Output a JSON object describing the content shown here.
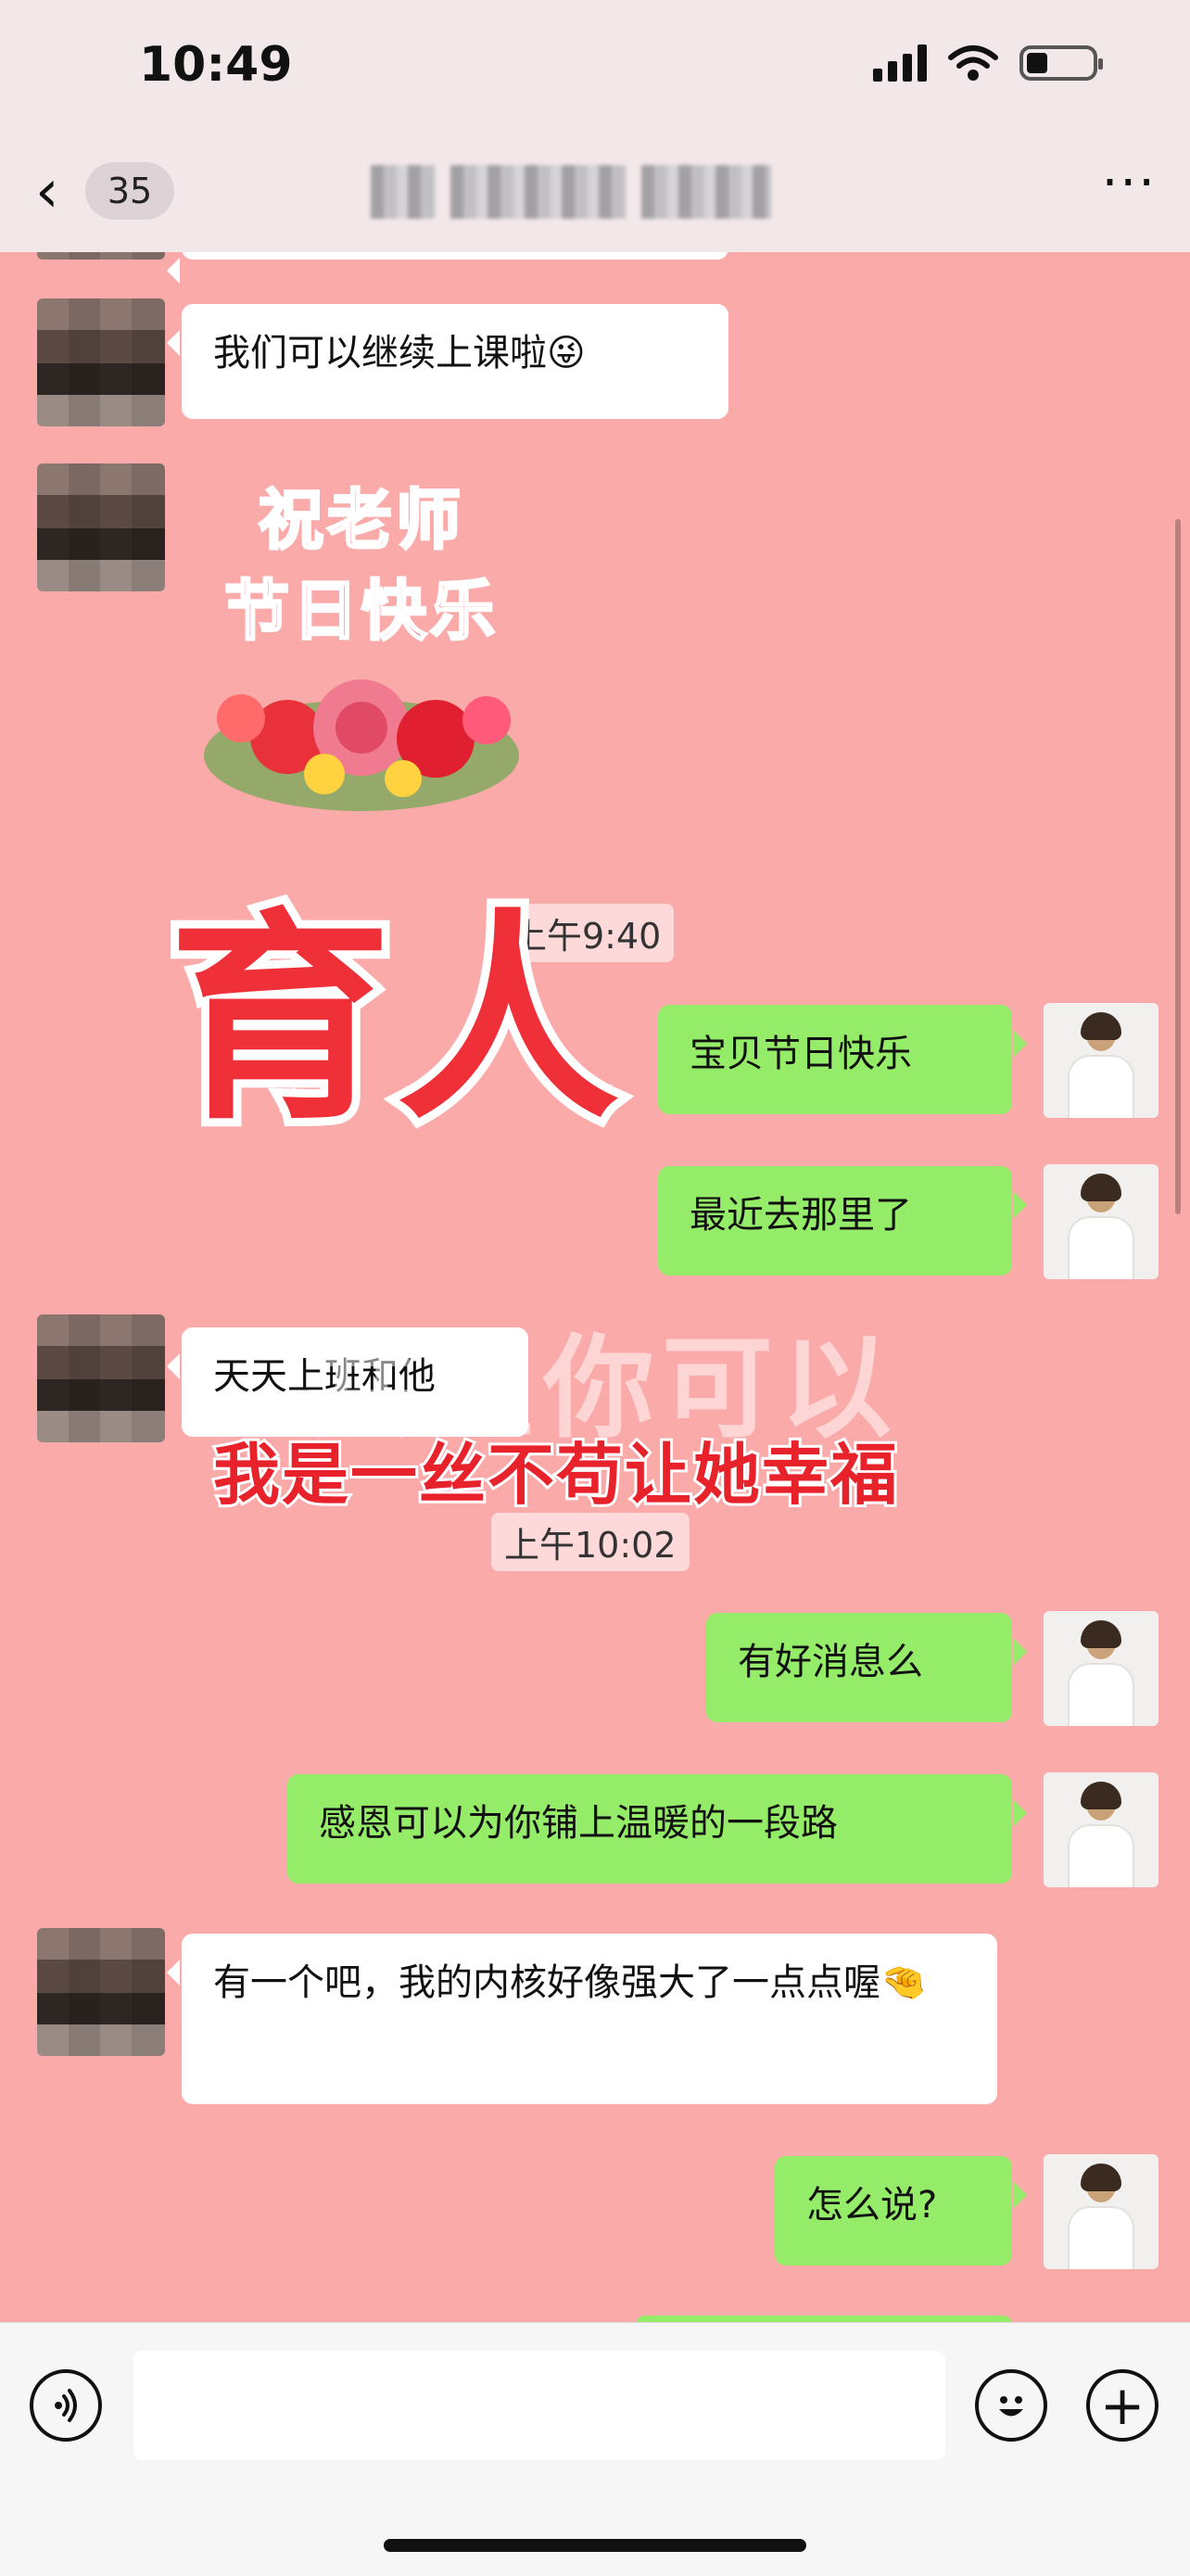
{
  "status_bar": {
    "time": "10:49"
  },
  "nav": {
    "back_glyph": "‹",
    "unread_count": "35",
    "more_glyph": "···"
  },
  "icons": {
    "signal": "signal-icon",
    "wifi": "wifi-icon",
    "battery": "battery-icon",
    "back": "chevron-left-icon",
    "more": "more-icon",
    "voice": "voice-icon",
    "emoji": "emoji-icon",
    "plus": "plus-icon"
  },
  "messages": [
    {
      "side": "in",
      "text": "我们可以继续上课啦😜"
    },
    {
      "side": "in",
      "type": "sticker",
      "line1": "祝老师",
      "line2": "节日快乐"
    },
    {
      "type": "timestamp",
      "text": "上午9:40"
    },
    {
      "side": "out",
      "text": "宝贝节日快乐"
    },
    {
      "side": "out",
      "text": "最近去那里了"
    },
    {
      "side": "in",
      "text": "天天上班和他"
    },
    {
      "type": "timestamp",
      "text": "上午10:02"
    },
    {
      "side": "out",
      "text": "有好消息么"
    },
    {
      "side": "out",
      "text": "感恩可以为你铺上温暖的一段路"
    },
    {
      "side": "in",
      "text": "有一个吧，我的内核好像强大了一点点喔🤏"
    },
    {
      "side": "out",
      "text": "怎么说?"
    }
  ],
  "overlay": {
    "headline": "育人",
    "faint_text": "共宝你可以",
    "caption": "我是一丝不苟让她幸福"
  },
  "footer": {
    "voice_glyph": "🔊",
    "emoji_glyph": "☺",
    "plus_glyph": "+"
  },
  "colors": {
    "chat_bg": "#fbaaaa",
    "outgoing_bubble": "#95ec69",
    "incoming_bubble": "#ffffff",
    "overlay_red": "#f03039"
  }
}
